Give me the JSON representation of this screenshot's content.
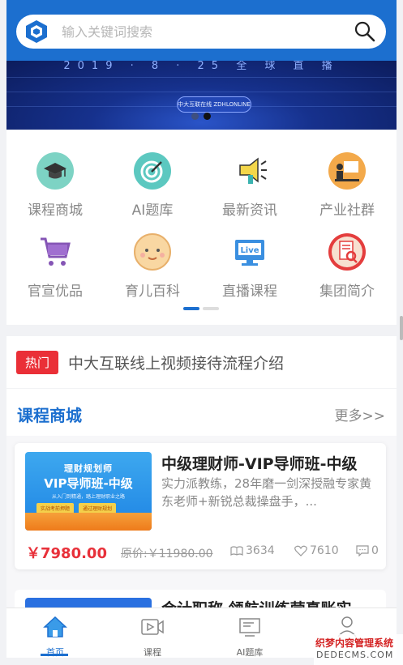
{
  "search": {
    "placeholder": "输入关键词搜索"
  },
  "banner": {
    "date_text": "2019 · 8 · 25 全 球 直 播",
    "badge_text": "中大互联在线 ZDHLONLINE"
  },
  "grid": {
    "items": [
      {
        "label": "课程商城",
        "icon": "graduation-cap-icon"
      },
      {
        "label": "AI题库",
        "icon": "target-icon"
      },
      {
        "label": "最新资讯",
        "icon": "megaphone-icon"
      },
      {
        "label": "产业社群",
        "icon": "presenter-icon"
      },
      {
        "label": "官宣优品",
        "icon": "shopping-cart-icon"
      },
      {
        "label": "育儿百科",
        "icon": "baby-face-icon"
      },
      {
        "label": "直播课程",
        "icon": "live-monitor-icon"
      },
      {
        "label": "集团简介",
        "icon": "document-magnifier-icon"
      }
    ]
  },
  "notice": {
    "tag": "热门",
    "text": "中大互联线上视频接待流程介绍"
  },
  "section": {
    "title": "课程商城",
    "more": "更多>>"
  },
  "course": {
    "thumb_line1": "理财规划师",
    "thumb_line2": "VIP导师班-中级",
    "thumb_line3": "从入门到精通，踏上理财职业之路",
    "thumb_tag1": "实战考前押题",
    "thumb_tag2": "通过理财规划",
    "title": "中级理财师-VIP导师班-中级",
    "desc": "实力派教练，28年磨一剑深授融专家黄东老师+新锐总裁操盘手，...",
    "price": "￥7980.00",
    "orig_price": "原价:￥11980.00",
    "views": "3634",
    "likes": "7610",
    "comments": "0"
  },
  "course2": {
    "title": "会计职称 领航训练营真账实"
  },
  "tabs": [
    {
      "label": "首页",
      "icon": "home-icon"
    },
    {
      "label": "课程",
      "icon": "video-icon"
    },
    {
      "label": "AI题库",
      "icon": "quiz-icon"
    },
    {
      "label": "",
      "icon": "user-icon"
    }
  ],
  "watermark": {
    "line1": "织梦内容管理系统",
    "line2": "DEDECMS.COM"
  },
  "colors": {
    "primary": "#1c6fcf",
    "hot": "#ea2f37",
    "price": "#e8313a"
  }
}
